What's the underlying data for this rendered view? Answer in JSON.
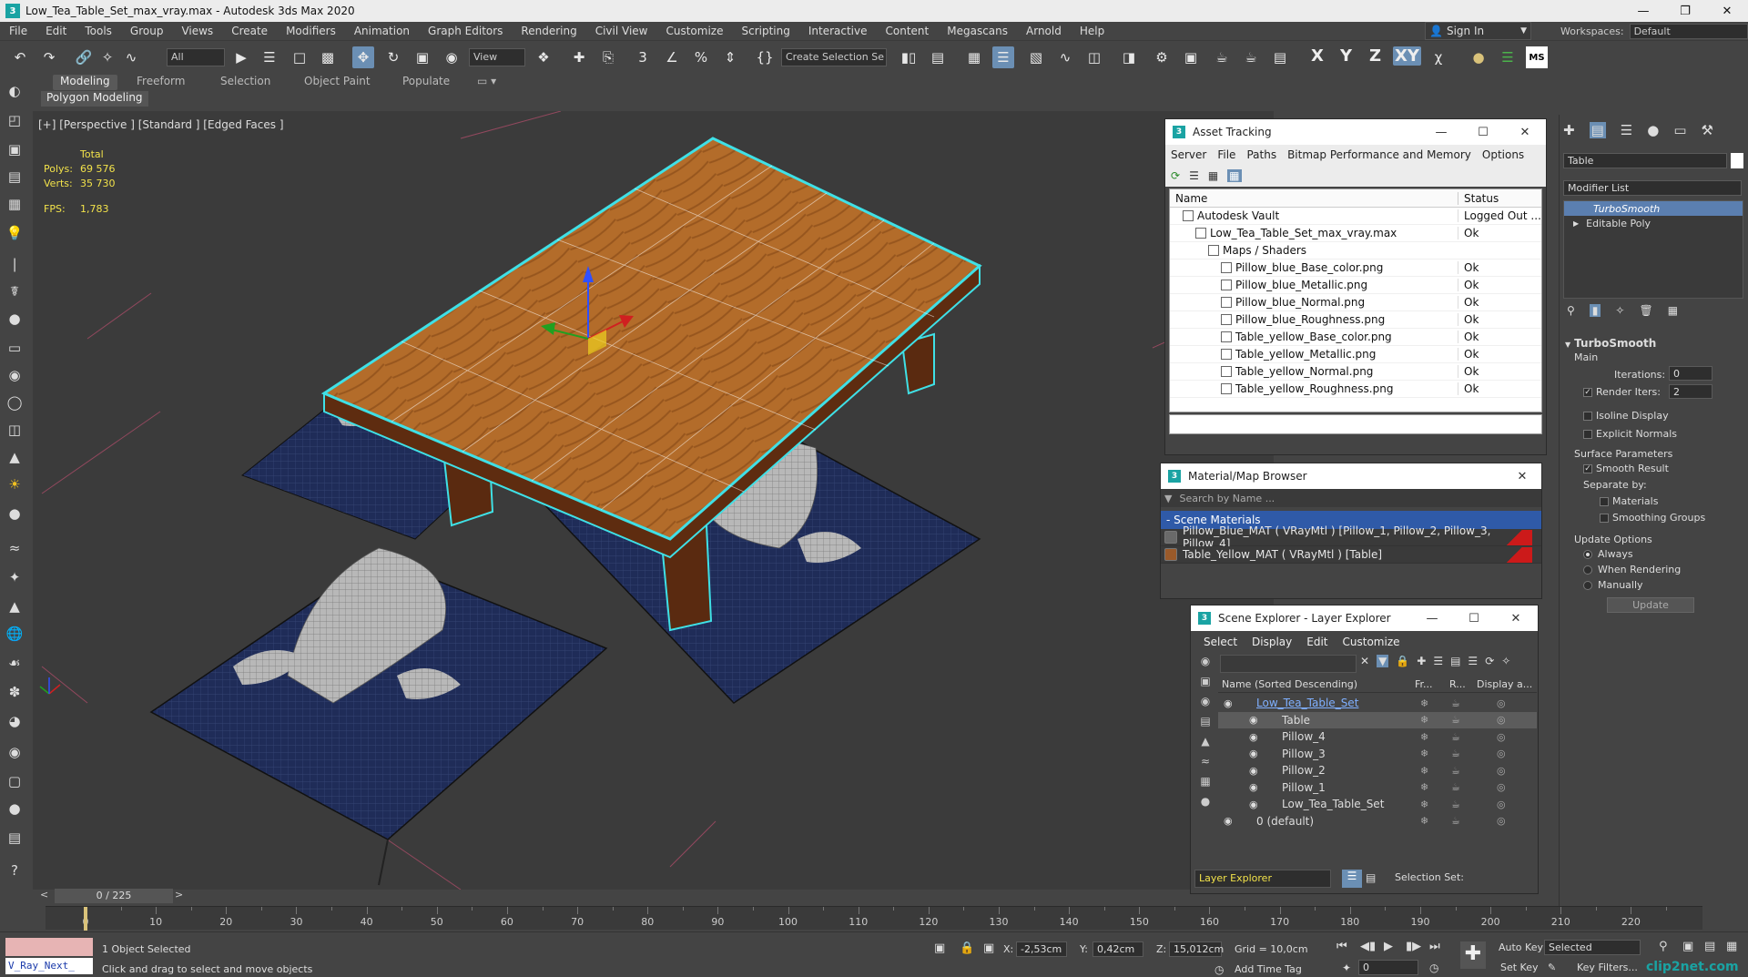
{
  "window": {
    "title": "Low_Tea_Table_Set_max_vray.max - Autodesk 3ds Max 2020",
    "app_icon": "3"
  },
  "menu": [
    "File",
    "Edit",
    "Tools",
    "Group",
    "Views",
    "Create",
    "Modifiers",
    "Animation",
    "Graph Editors",
    "Rendering",
    "Civil View",
    "Customize",
    "Scripting",
    "Interactive",
    "Content",
    "Megascans",
    "Arnold",
    "Help"
  ],
  "signin_label": "Sign In",
  "workspaces": {
    "label": "Workspaces:",
    "value": "Default"
  },
  "toolbar": {
    "filter_value": "All",
    "view_value": "View",
    "create_selection_set": "Create Selection Se",
    "axis_labels": [
      "X",
      "Y",
      "Z",
      "XY"
    ]
  },
  "ribbon": {
    "tabs": [
      "Modeling",
      "Freeform",
      "Selection",
      "Object Paint",
      "Populate"
    ],
    "active_tab": "Modeling",
    "sub_label": "Polygon Modeling"
  },
  "viewport": {
    "label": "[+] [Perspective ] [Standard ] [Edged Faces ]",
    "stats": {
      "total_label": "Total",
      "polys_label": "Polys:",
      "polys_value": "69 576",
      "verts_label": "Verts:",
      "verts_value": "35 730",
      "fps_label": "FPS:",
      "fps_value": "1,783"
    }
  },
  "asset_tracking": {
    "title": "Asset Tracking",
    "menu": [
      "Server",
      "File",
      "Paths",
      "Bitmap Performance and Memory",
      "Options"
    ],
    "columns": [
      "Name",
      "Status"
    ],
    "rows": [
      {
        "indent": 1,
        "name": "Autodesk Vault",
        "status": "Logged Out ..."
      },
      {
        "indent": 2,
        "name": "Low_Tea_Table_Set_max_vray.max",
        "status": "Ok"
      },
      {
        "indent": 3,
        "name": "Maps / Shaders",
        "status": ""
      },
      {
        "indent": 4,
        "name": "Pillow_blue_Base_color.png",
        "status": "Ok"
      },
      {
        "indent": 4,
        "name": "Pillow_blue_Metallic.png",
        "status": "Ok"
      },
      {
        "indent": 4,
        "name": "Pillow_blue_Normal.png",
        "status": "Ok"
      },
      {
        "indent": 4,
        "name": "Pillow_blue_Roughness.png",
        "status": "Ok"
      },
      {
        "indent": 4,
        "name": "Table_yellow_Base_color.png",
        "status": "Ok"
      },
      {
        "indent": 4,
        "name": "Table_yellow_Metallic.png",
        "status": "Ok"
      },
      {
        "indent": 4,
        "name": "Table_yellow_Normal.png",
        "status": "Ok"
      },
      {
        "indent": 4,
        "name": "Table_yellow_Roughness.png",
        "status": "Ok"
      }
    ]
  },
  "material_browser": {
    "title": "Material/Map Browser",
    "search_placeholder": "Search by Name ...",
    "section": "- Scene Materials",
    "items": [
      "Pillow_Blue_MAT ( VRayMtl ) [Pillow_1, Pillow_2, Pillow_3, Pillow_4]",
      "Table_Yellow_MAT ( VRayMtl ) [Table]"
    ]
  },
  "scene_explorer": {
    "title": "Scene Explorer - Layer Explorer",
    "menu": [
      "Select",
      "Display",
      "Edit",
      "Customize"
    ],
    "columns": [
      "Name (Sorted Descending)",
      "Fr...",
      "R...",
      "Display a..."
    ],
    "rows": [
      {
        "indent": 0,
        "name": "Low_Tea_Table_Set",
        "selected": false
      },
      {
        "indent": 1,
        "name": "Table",
        "selected": true
      },
      {
        "indent": 1,
        "name": "Pillow_4",
        "selected": false
      },
      {
        "indent": 1,
        "name": "Pillow_3",
        "selected": false
      },
      {
        "indent": 1,
        "name": "Pillow_2",
        "selected": false
      },
      {
        "indent": 1,
        "name": "Pillow_1",
        "selected": false
      },
      {
        "indent": 1,
        "name": "Low_Tea_Table_Set",
        "selected": false
      },
      {
        "indent": 0,
        "name": "0 (default)",
        "selected": false
      }
    ],
    "footer_layer": "Layer Explorer",
    "footer_selection_set": "Selection Set:"
  },
  "command_panel": {
    "object_name": "Table",
    "modifier_list": "Modifier List",
    "stack": [
      "TurboSmooth",
      "Editable Poly"
    ],
    "rollout_title": "TurboSmooth",
    "main_label": "Main",
    "iterations_label": "Iterations:",
    "iterations_value": "0",
    "render_iters_label": "Render Iters:",
    "render_iters_value": "2",
    "isoline": "Isoline Display",
    "explicit_normals": "Explicit Normals",
    "surface_params": "Surface Parameters",
    "smooth_result": "Smooth Result",
    "separate_by": "Separate by:",
    "materials": "Materials",
    "smoothing_groups": "Smoothing Groups",
    "update_options": "Update Options",
    "always": "Always",
    "when_rendering": "When Rendering",
    "manually": "Manually",
    "update_button": "Update"
  },
  "timeline": {
    "frame_display": "0 / 225",
    "ticks": [
      0,
      10,
      20,
      30,
      40,
      50,
      60,
      70,
      80,
      90,
      100,
      110,
      120,
      130,
      140,
      150,
      160,
      170,
      180,
      190,
      200,
      210,
      220
    ]
  },
  "status": {
    "script_label": "V_Ray_Next_",
    "selection": "1 Object Selected",
    "prompt": "Click and drag to select and move objects",
    "x_label": "X:",
    "x_value": "-2,53cm",
    "y_label": "Y:",
    "y_value": "0,42cm",
    "z_label": "Z:",
    "z_value": "15,012cm",
    "grid": "Grid = 10,0cm",
    "add_time_tag": "Add Time Tag",
    "auto_key": "Auto Key",
    "set_key": "Set Key",
    "key_mode": "Selected",
    "key_filters": "Key Filters...",
    "frame_value": "0",
    "watermark": "clip2net.com"
  },
  "colors": {
    "selection_outline": "#3fe0e6",
    "pillow": "#1e2d5a",
    "table_wood": "#b06a2a",
    "accent_blue": "#6b8fb4"
  }
}
